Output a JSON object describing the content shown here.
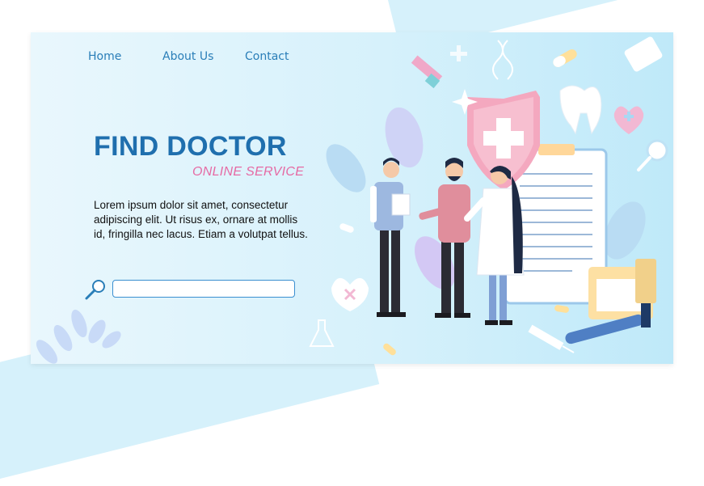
{
  "nav": {
    "items": [
      {
        "label": "Home"
      },
      {
        "label": "About Us"
      },
      {
        "label": "Contact"
      }
    ]
  },
  "hero": {
    "title": "FIND DOCTOR",
    "subtitle": "ONLINE SERVICE",
    "description": "Lorem ipsum dolor sit amet, consectetur adipiscing elit. Ut risus ex, ornare at mollis id, fringilla nec lacus. Etiam a volutpat tellus."
  },
  "search": {
    "value": "",
    "placeholder": ""
  },
  "colors": {
    "accent_blue": "#1f6fae",
    "accent_pink": "#e66aa4",
    "background": "#d6f1fb"
  },
  "icons": [
    "search-icon",
    "shield-cross-icon",
    "tooth-icon",
    "heart-icon",
    "pill-icon",
    "syringe-icon",
    "dna-icon",
    "flask-icon",
    "clipboard-icon",
    "medicine-bottle-icon"
  ]
}
